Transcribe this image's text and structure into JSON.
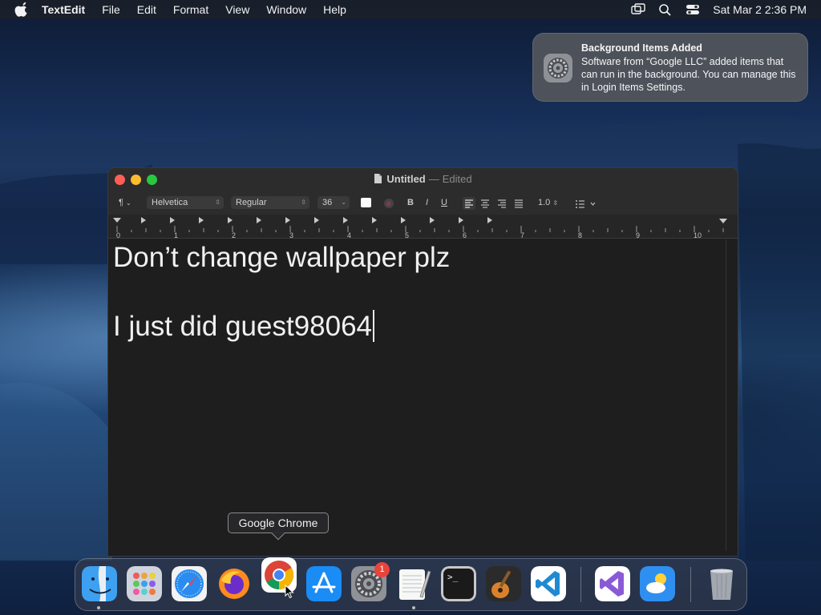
{
  "menubar": {
    "app_name": "TextEdit",
    "items": [
      "File",
      "Edit",
      "Format",
      "View",
      "Window",
      "Help"
    ],
    "clock": "Sat Mar 2  2:36 PM"
  },
  "notification": {
    "title": "Background Items Added",
    "body": "Software from “Google LLC” added items that can run in the background. You can manage this in Login Items Settings."
  },
  "window": {
    "title": "Untitled",
    "separator": "—",
    "status": "Edited",
    "toolbar": {
      "paragraph_glyph": "¶",
      "font_family": "Helvetica",
      "font_style": "Regular",
      "font_size": "36",
      "bold": "B",
      "italic": "I",
      "underline": "U",
      "line_spacing": "1.0"
    },
    "ruler_numbers": [
      "0",
      "1",
      "2",
      "3",
      "4",
      "5",
      "6",
      "7",
      "8",
      "9",
      "10"
    ],
    "document": {
      "line1": "Don’t change wallpaper plz",
      "line2": "I just did guest98064"
    }
  },
  "tooltip": "Google Chrome",
  "dock": {
    "apps": [
      "Finder",
      "Launchpad",
      "Safari",
      "Firefox",
      "Google Chrome",
      "App Store",
      "System Settings",
      "TextEdit",
      "Terminal",
      "GarageBand",
      "Visual Studio Code",
      "Visual Studio",
      "Weather",
      "Trash"
    ],
    "badge_count": "1"
  },
  "colors": {
    "close": "#ff5f57",
    "minimize": "#febc2e",
    "maximize": "#28c840",
    "badge": "#e8443a"
  }
}
